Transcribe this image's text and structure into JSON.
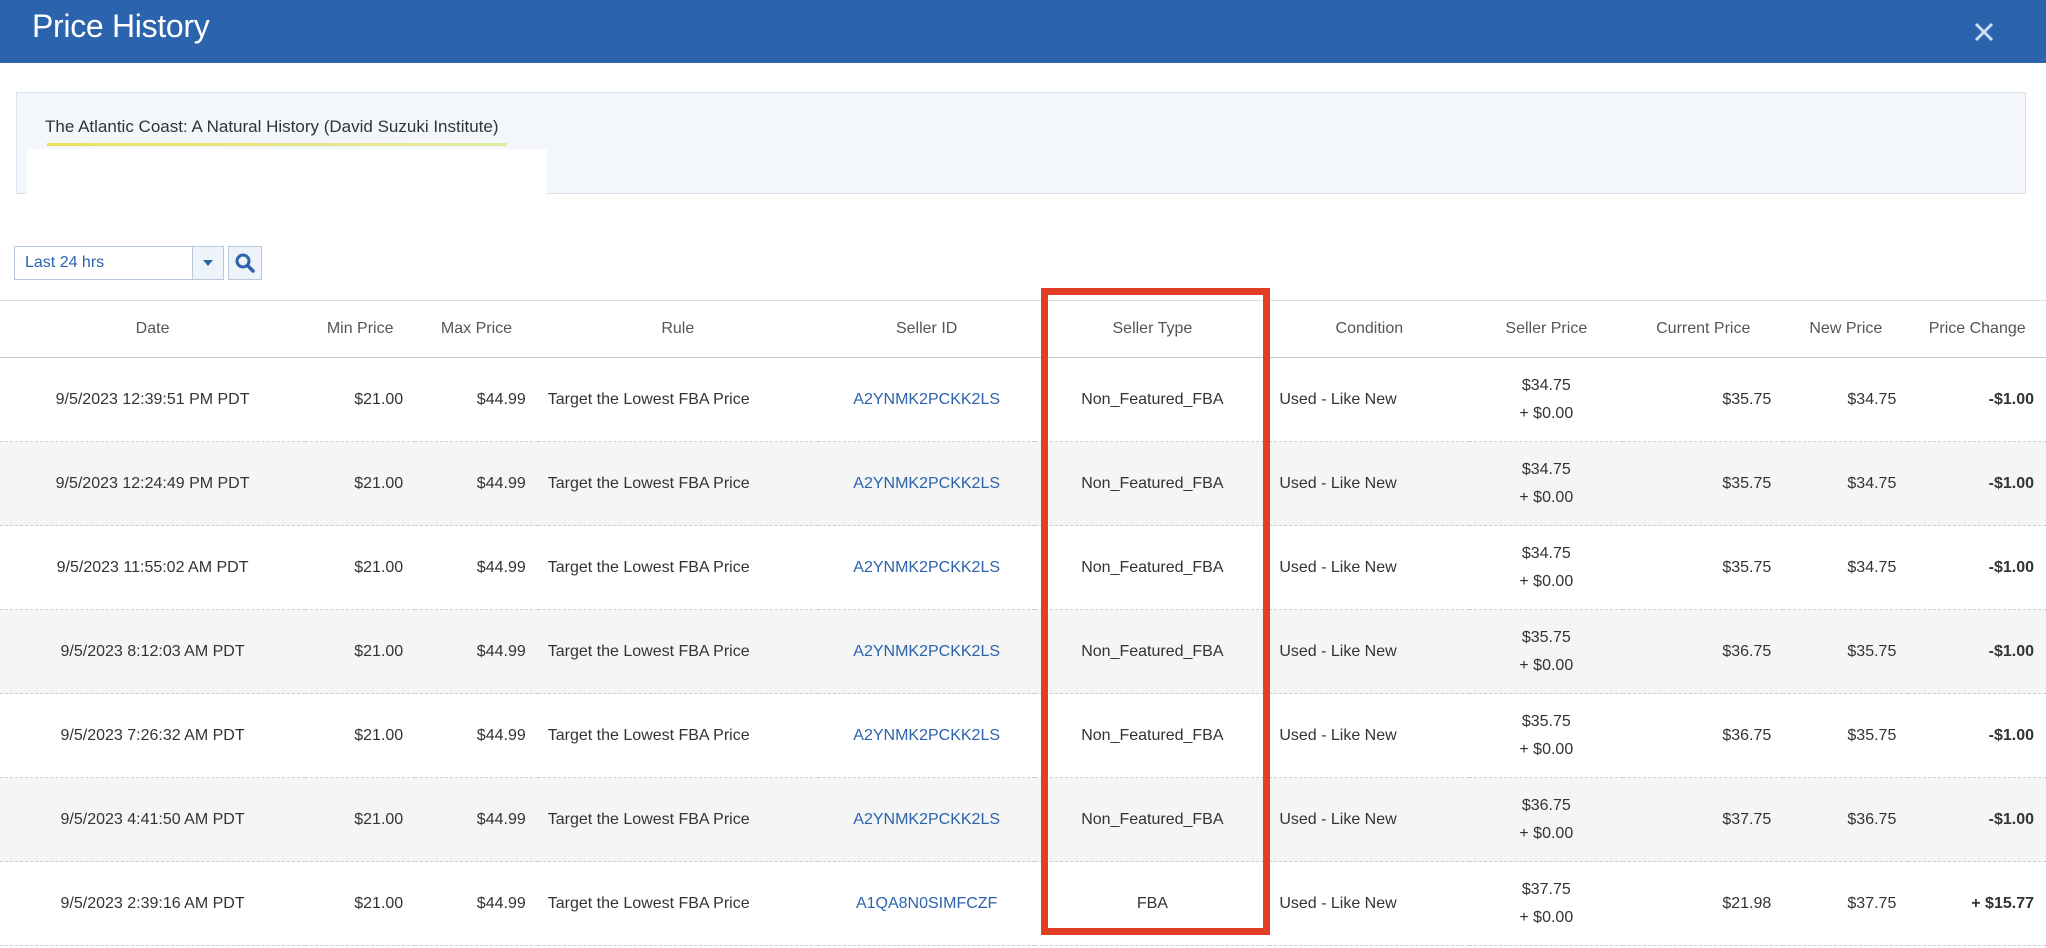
{
  "dialog": {
    "title": "Price History",
    "close_icon": "close-icon"
  },
  "product": {
    "title": "The Atlantic Coast: A Natural History (David Suzuki Institute)"
  },
  "filter": {
    "range_value": "Last 24 hrs",
    "dropdown_icon": "chevron-down-icon",
    "search_icon": "search-icon"
  },
  "table": {
    "headers": [
      "Date",
      "Min Price",
      "Max Price",
      "Rule",
      "Seller ID",
      "Seller Type",
      "Condition",
      "Seller Price",
      "Current Price",
      "New Price",
      "Price Change"
    ],
    "rows": [
      {
        "date": "9/5/2023 12:39:51 PM PDT",
        "min": "$21.00",
        "max": "$44.99",
        "rule": "Target the Lowest FBA Price",
        "seller_id": "A2YNMK2PCKK2LS",
        "seller_type": "Non_Featured_FBA",
        "condition": "Used - Like New",
        "seller_price": "$34.75",
        "shipping": "+ $0.00",
        "current": "$35.75",
        "new": "$34.75",
        "change": "-$1.00",
        "change_sign": "neg"
      },
      {
        "date": "9/5/2023 12:24:49 PM PDT",
        "min": "$21.00",
        "max": "$44.99",
        "rule": "Target the Lowest FBA Price",
        "seller_id": "A2YNMK2PCKK2LS",
        "seller_type": "Non_Featured_FBA",
        "condition": "Used - Like New",
        "seller_price": "$34.75",
        "shipping": "+ $0.00",
        "current": "$35.75",
        "new": "$34.75",
        "change": "-$1.00",
        "change_sign": "neg"
      },
      {
        "date": "9/5/2023 11:55:02 AM PDT",
        "min": "$21.00",
        "max": "$44.99",
        "rule": "Target the Lowest FBA Price",
        "seller_id": "A2YNMK2PCKK2LS",
        "seller_type": "Non_Featured_FBA",
        "condition": "Used - Like New",
        "seller_price": "$34.75",
        "shipping": "+ $0.00",
        "current": "$35.75",
        "new": "$34.75",
        "change": "-$1.00",
        "change_sign": "neg"
      },
      {
        "date": "9/5/2023 8:12:03 AM PDT",
        "min": "$21.00",
        "max": "$44.99",
        "rule": "Target the Lowest FBA Price",
        "seller_id": "A2YNMK2PCKK2LS",
        "seller_type": "Non_Featured_FBA",
        "condition": "Used - Like New",
        "seller_price": "$35.75",
        "shipping": "+ $0.00",
        "current": "$36.75",
        "new": "$35.75",
        "change": "-$1.00",
        "change_sign": "neg"
      },
      {
        "date": "9/5/2023 7:26:32 AM PDT",
        "min": "$21.00",
        "max": "$44.99",
        "rule": "Target the Lowest FBA Price",
        "seller_id": "A2YNMK2PCKK2LS",
        "seller_type": "Non_Featured_FBA",
        "condition": "Used - Like New",
        "seller_price": "$35.75",
        "shipping": "+ $0.00",
        "current": "$36.75",
        "new": "$35.75",
        "change": "-$1.00",
        "change_sign": "neg"
      },
      {
        "date": "9/5/2023 4:41:50 AM PDT",
        "min": "$21.00",
        "max": "$44.99",
        "rule": "Target the Lowest FBA Price",
        "seller_id": "A2YNMK2PCKK2LS",
        "seller_type": "Non_Featured_FBA",
        "condition": "Used - Like New",
        "seller_price": "$36.75",
        "shipping": "+ $0.00",
        "current": "$37.75",
        "new": "$36.75",
        "change": "-$1.00",
        "change_sign": "neg"
      },
      {
        "date": "9/5/2023 2:39:16 AM PDT",
        "min": "$21.00",
        "max": "$44.99",
        "rule": "Target the Lowest FBA Price",
        "seller_id": "A1QA8N0SIMFCZF",
        "seller_type": "FBA",
        "condition": "Used - Like New",
        "seller_price": "$37.75",
        "shipping": "+ $0.00",
        "current": "$21.98",
        "new": "$37.75",
        "change": "+ $15.77",
        "change_sign": "pos"
      }
    ]
  },
  "colors": {
    "header_bar": "#2b63ad",
    "highlight_box": "#e23d25",
    "negative": "#c0262d",
    "positive": "#2e8b2e"
  }
}
